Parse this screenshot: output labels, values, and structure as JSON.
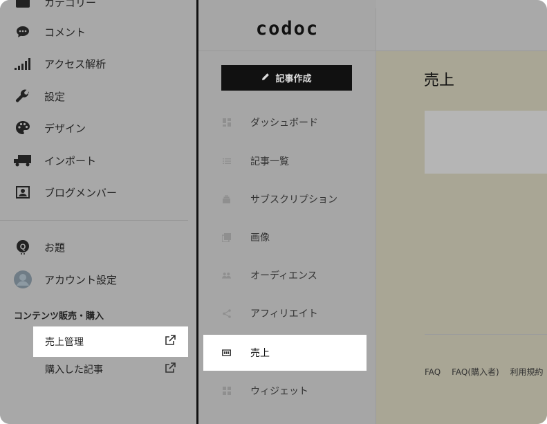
{
  "left_sidebar": {
    "items": [
      {
        "label": "カテゴリー",
        "icon": "folder-icon"
      },
      {
        "label": "コメント",
        "icon": "comment-icon"
      },
      {
        "label": "アクセス解析",
        "icon": "signal-bars-icon"
      },
      {
        "label": "設定",
        "icon": "wrench-icon"
      },
      {
        "label": "デザイン",
        "icon": "palette-icon"
      },
      {
        "label": "インポート",
        "icon": "truck-icon"
      },
      {
        "label": "ブログメンバー",
        "icon": "member-card-icon"
      }
    ],
    "items2": [
      {
        "label": "お題",
        "icon": "odai-icon"
      },
      {
        "label": "アカウント設定",
        "icon": "avatar-icon"
      }
    ],
    "section_title": "コンテンツ販売・購入",
    "sub_items": [
      {
        "label": "売上管理",
        "icon": "external-link-icon"
      },
      {
        "label": "購入した記事",
        "icon": "external-link-icon"
      }
    ]
  },
  "codoc": {
    "logo": "codoc",
    "create_button": "記事作成",
    "nav": [
      {
        "label": "ダッシュボード",
        "icon": "dashboard-icon"
      },
      {
        "label": "記事一覧",
        "icon": "list-icon"
      },
      {
        "label": "サブスクリプション",
        "icon": "subscription-icon"
      },
      {
        "label": "画像",
        "icon": "image-icon"
      },
      {
        "label": "オーディエンス",
        "icon": "audience-icon"
      },
      {
        "label": "アフィリエイト",
        "icon": "share-icon"
      },
      {
        "label": "売上",
        "icon": "sales-icon"
      },
      {
        "label": "ウィジェット",
        "icon": "widget-icon"
      }
    ]
  },
  "main": {
    "title": "売上",
    "footer_links": [
      "FAQ",
      "FAQ(購入者)",
      "利用規約"
    ]
  }
}
